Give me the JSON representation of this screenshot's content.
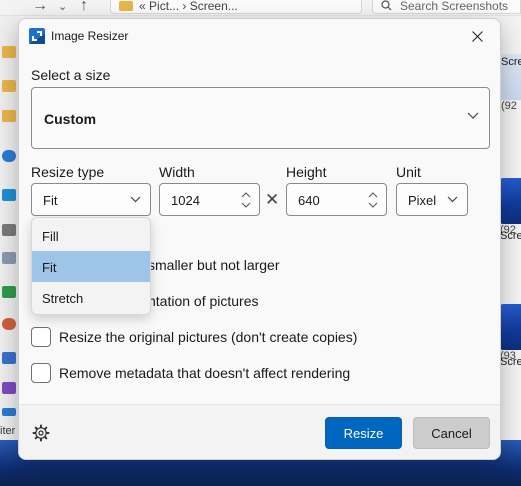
{
  "background": {
    "address_prefix": "«",
    "address_crumbs": [
      "Pict...",
      "Screen..."
    ],
    "address_separator": "›",
    "search_placeholder": "Search Screenshots",
    "left_label": "iter",
    "thumbnails": [
      {
        "label": "Scre",
        "size": "(92"
      },
      {
        "label": "Scre",
        "size": "(92"
      },
      {
        "label": "Scre",
        "size": "(93"
      }
    ]
  },
  "dialog": {
    "title": "Image Resizer",
    "select_size_label": "Select a size",
    "size_value": "Custom",
    "resize_type_label": "Resize type",
    "resize_type_value": "Fit",
    "width_label": "Width",
    "width_value": "1024",
    "height_label": "Height",
    "height_value": "640",
    "times_sign": "✕",
    "unit_label": "Unit",
    "unit_value": "Pixel",
    "resize_type_options": [
      "Fill",
      "Fit",
      "Stretch"
    ],
    "resize_type_selected_index": 1,
    "options": [
      {
        "label": "smaller but not larger",
        "checked": false
      },
      {
        "label": "ntation of pictures",
        "checked": false
      },
      {
        "label": "Resize the original pictures (don't create copies)",
        "checked": false
      },
      {
        "label": "Remove metadata that doesn't affect rendering",
        "checked": false
      }
    ],
    "resize_button": "Resize",
    "cancel_button": "Cancel"
  },
  "colors": {
    "accent": "#0067c0",
    "dropdown_highlight": "#9ec5e8",
    "wallpaper": "#1d3f7a"
  }
}
